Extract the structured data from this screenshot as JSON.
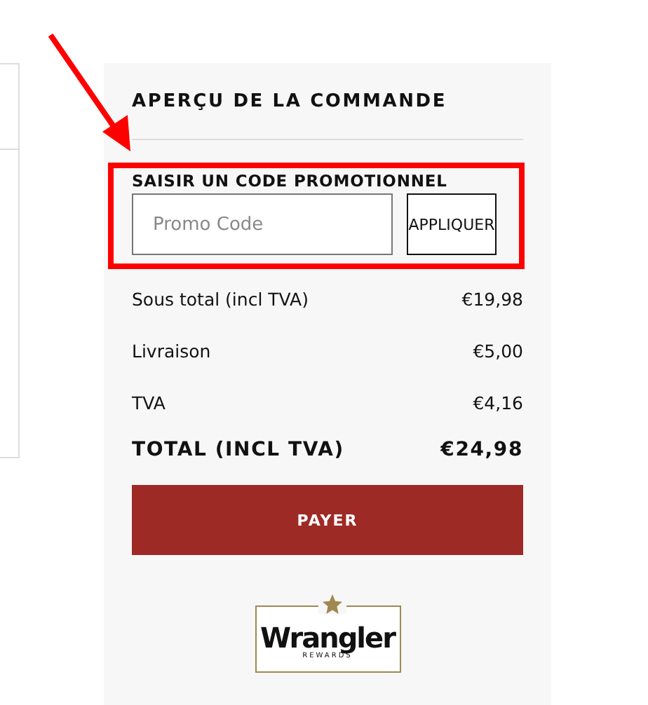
{
  "order_summary": {
    "title": "APERÇU DE LA COMMANDE",
    "promo": {
      "label": "SAISIR UN CODE PROMOTIONNEL",
      "placeholder": "Promo Code",
      "button": "APPLIQUER"
    },
    "lines": [
      {
        "label": "Sous total (incl TVA)",
        "value": "€19,98",
        "kind": "normal"
      },
      {
        "label": "Livraison",
        "value": "€5,00",
        "kind": "normal"
      },
      {
        "label": "TVA",
        "value": "€4,16",
        "kind": "normal"
      },
      {
        "label": "TOTAL (INCL TVA)",
        "value": "€24,98",
        "kind": "total"
      }
    ],
    "pay_button": "PAYER",
    "logo": {
      "name": "Wrangler",
      "sub": "REWARDS"
    }
  }
}
